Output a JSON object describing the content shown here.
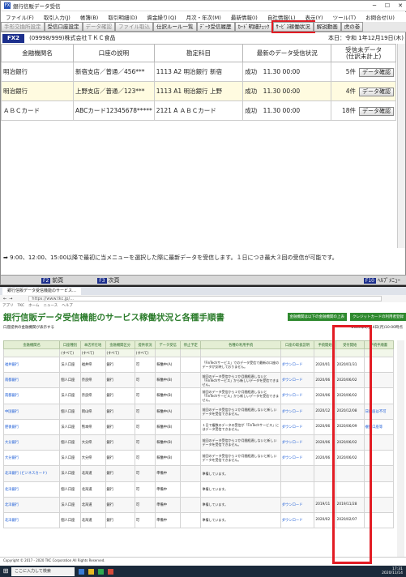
{
  "app": {
    "title": "銀行信販データ受信",
    "menu": [
      "ファイル(F)",
      "取引入力(J)",
      "帳簿(B)",
      "取引明細(D)",
      "資金繰り(Q)",
      "月次・年次(M)",
      "最新情報(I)",
      "自社情報(L)",
      "表示(Y)",
      "ツール(T)",
      "お問合せ(U)"
    ],
    "toolbar": [
      "手形交換所設定",
      "受信口座設定",
      "データ確認",
      "ファイル取込",
      "仕訳ルール一覧",
      "ﾃﾞｰﾀ受信履歴",
      "ｶｰﾄﾞ明細ﾁｪｯｸ",
      "ｻｰﾋﾞｽ稼働状況",
      "解説動画",
      "虎の巻"
    ],
    "highlighted_tool": "ｻｰﾋﾞｽ稼働状況",
    "fx_badge": "FX2",
    "company": "(09998/999)株式会社ＴＫＣ食品",
    "date": "本日：令和 1年12月19日(木)",
    "columns": [
      "金融機関名",
      "口座の説明",
      "勘定科目",
      "最新のデータ受信状況",
      "受信未データ\n(仕訳未計上)"
    ],
    "rows": [
      {
        "bank": "明治銀行",
        "account": "新宿支店／普通／456***",
        "subject": "1113 A2 明治銀行 新宿",
        "status": "成功　11.30 00:00",
        "count": "5件",
        "btn": "データ確認"
      },
      {
        "bank": "明治銀行",
        "account": "上野支店／普通／123***",
        "subject": "1113 A1 明治銀行 上野",
        "status": "成功　11.30 00:00",
        "count": "4件",
        "btn": "データ確認"
      },
      {
        "bank": "ＡＢＣカード",
        "account": "ABCカード12345678*****",
        "subject": "2121 A ＡＢＣカード",
        "status": "成功　11.30 00:00",
        "count": "18件",
        "btn": "データ確認"
      }
    ],
    "notice": "9:00、12:00、15:00以降で最初に当メニューを選択した際に最新データを受信します。１日につき最大３回の受信が可能です。",
    "nav": {
      "prev_key": "F2",
      "prev": "前頁",
      "next_key": "F3",
      "next": "次頁",
      "help_key": "F10",
      "help": "ﾍﾙﾌﾟﾒﾆｭｰ"
    }
  },
  "browser": {
    "tab": "銀行信販データ受信機能のサービス…",
    "url": "https://www.tkc.jp/...",
    "bookmarks": [
      "アプリ",
      "TKC",
      "ホーム",
      "ニュース",
      "ヘルプ"
    ],
    "heading": "銀行信販データ受信機能のサービス稼働状況と各種手順書",
    "btn1": "金融機関は以下の金融機関の上表",
    "btn2": "クレジットカードの利用者登録",
    "sub_left": "口座提供の金融機関が表示する",
    "sub_right": "2020年1月14日(月)10:00時点",
    "columns": [
      "金融機関名",
      "口座種別",
      "本店所在地",
      "金融機関区分",
      "提供状況",
      "データ受信",
      "停止予定",
      "稼働状況",
      "各種の利用手続",
      "口座の取扱説明",
      "手続開始",
      "受付開始",
      "手続手順書"
    ],
    "filter": [
      "(すべて)",
      "(すべて)",
      "(すべて)",
      "(すべて)"
    ],
    "rows": [
      [
        "福井銀行",
        "法人口座",
        "福井県",
        "銀行",
        "可",
        "稼働中(A)",
        "",
        "「FinTechサービス」でのデータ受信で最新の口座のデータが反映しておりません。",
        "ダウンロード",
        "2020/01",
        "2020/01/31",
        ""
      ],
      [
        "南都銀行",
        "個人口座",
        "奈良県",
        "銀行",
        "可",
        "稼働中(B)",
        "",
        "前回のデータ受信から２か月間経過しないと「FinTechサービス」から新しいデータを受信できません。",
        "ダウンロード",
        "2020/06",
        "2020/06/02",
        ""
      ],
      [
        "南都銀行",
        "法人口座",
        "奈良県",
        "銀行",
        "可",
        "稼働中(B)",
        "",
        "前回のデータ受信から２か月間経過しないと「FinTechサービス」から新しいデータを受信できません。",
        "ダウンロード",
        "2020/06",
        "2020/06/02",
        ""
      ],
      [
        "中国銀行",
        "個人口座",
        "岡山県",
        "銀行",
        "可",
        "稼働中(A)",
        "",
        "前回のデータ受信から２か月間経過しないと新しいデータを受信できません。",
        "ダウンロード",
        "2020/12",
        "2020/12/08",
        "日口座は不可"
      ],
      [
        "肥後銀行",
        "法人口座",
        "熊本県",
        "銀行",
        "可",
        "稼働中(B)",
        "",
        "１日で複数のデータの受信が「FinTechサービス」にはデータ受信できません。",
        "ダウンロード",
        "2020/06",
        "2020/06/09",
        "複数口座等"
      ],
      [
        "大分銀行",
        "個人口座",
        "大分県",
        "銀行",
        "可",
        "稼働中(B)",
        "",
        "前回のデータ受信から２か月間経過しないと新しいデータを受信できません。",
        "ダウンロード",
        "2020/06",
        "2020/06/02",
        ""
      ],
      [
        "大分銀行",
        "法人口座",
        "大分県",
        "銀行",
        "可",
        "稼働中(B)",
        "",
        "前回のデータ受信から２か月間経過しないと新しいデータを受信できません。",
        "ダウンロード",
        "2020/06",
        "2020/06/02",
        ""
      ],
      [
        "北洋銀行 (ビジネスカード)",
        "法人口座",
        "北海道",
        "銀行",
        "可",
        "準備中",
        "",
        "準備しています。",
        "",
        "",
        "",
        ""
      ],
      [
        "北洋銀行",
        "個人口座",
        "北海道",
        "銀行",
        "可",
        "準備中",
        "",
        "準備しています。",
        "",
        "",
        "",
        ""
      ],
      [
        "北洋銀行",
        "法人口座",
        "北海道",
        "銀行",
        "可",
        "準備中",
        "",
        "準備しています。",
        "ダウンロード",
        "2019/11",
        "2019/11/28",
        ""
      ],
      [
        "北洋銀行",
        "個人口座",
        "北海道",
        "銀行",
        "可",
        "準備中",
        "",
        "準備しています。",
        "ダウンロード",
        "2020/02",
        "2020/02/07",
        ""
      ]
    ],
    "footer": "Copyright © 2017 - 2020 TKC Corporation All Rights Reserved."
  },
  "taskbar": {
    "search": "ここに入力して検索",
    "time": "17:31",
    "date": "2020/11/14"
  }
}
